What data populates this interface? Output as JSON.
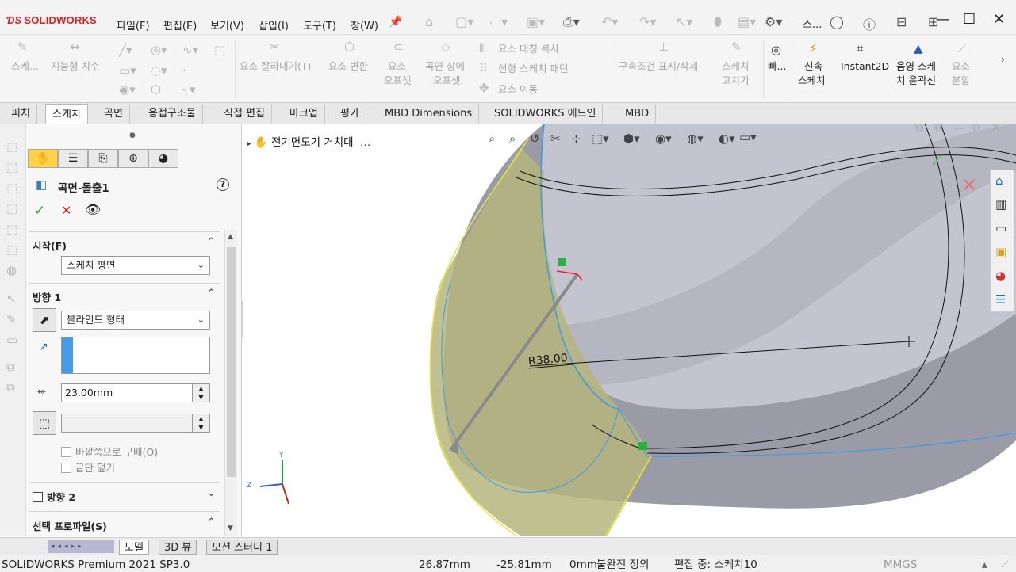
{
  "app": {
    "logo": "SOLIDWORKS"
  },
  "menu": [
    "파일(F)",
    "편집(E)",
    "보기(V)",
    "삽입(I)",
    "도구(T)",
    "창(W)"
  ],
  "title_right": "스...",
  "commands": {
    "sketch": "스케...",
    "smart_dim": "지능형 치수",
    "trim": "요소 잘라내기(T)",
    "convert": "요소 변환",
    "offset_l1": "요소",
    "offset_l2": "오프셋",
    "surf_offset_l1": "곡면 상에",
    "surf_offset_l2": "오프셋",
    "mirror": "요소 대칭 복사",
    "linear_pattern": "선형 스케치 패턴",
    "move": "요소 이동",
    "relations": "구속조건 표시/삭제",
    "repair_l1": "스케치",
    "repair_l2": "고치기",
    "quick": "빠...",
    "rapid_l1": "신속",
    "rapid_l2": "스케치",
    "instant2d": "Instant2D",
    "shaded_l1": "음영 스케",
    "shaded_l2": "치 윤곽선",
    "split_l1": "요소",
    "split_l2": "분할"
  },
  "tabs": [
    "피처",
    "스케치",
    "곡면",
    "용접구조물",
    "직접 편집",
    "마크업",
    "평가",
    "MBD Dimensions",
    "SOLIDWORKS 애드인",
    "MBD"
  ],
  "pm": {
    "title": "곡면-돌출1",
    "help": "?",
    "start": {
      "header": "시작(F)",
      "value": "스케치 평면"
    },
    "direction1": {
      "header": "방향 1",
      "type": "블라인드 형태",
      "depth": "23.00mm"
    },
    "draft_outward": "바깥쪽으로 구배(O)",
    "cap_end": "끝단 덮기",
    "direction2": "방향 2",
    "selected_profiles": "선택 프로파일(S)"
  },
  "viewport": {
    "tree_root": "전기면도기 거치대",
    "dimension": "R38.00",
    "axes": {
      "x": "",
      "y": "Y",
      "z": "Z"
    }
  },
  "bottom_tabs": [
    "모델",
    "3D 뷰",
    "모션 스터디 1"
  ],
  "status": {
    "product": "SOLIDWORKS Premium 2021 SP3.0",
    "x": "26.87mm",
    "y": "-25.81mm",
    "z": "0mm",
    "definition": "불완전 정의",
    "editing": "편집 중: 스케치10",
    "units": "MMGS"
  },
  "colors": {
    "accent_red": "#d32027",
    "extrude_preview": "#b6b57e",
    "edge_blue": "#3b9be8",
    "tab_selected": "#ffffff"
  }
}
